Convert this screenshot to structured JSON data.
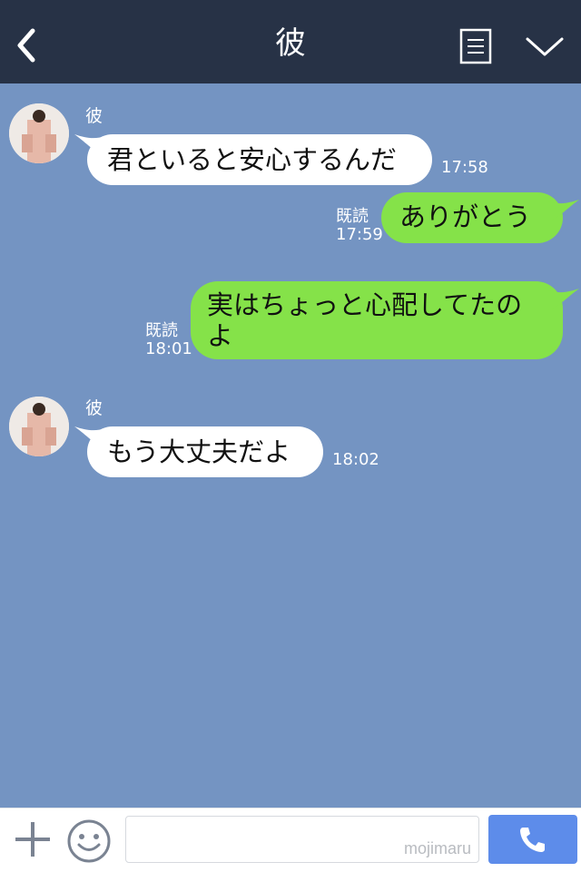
{
  "header": {
    "title": "彼",
    "back_icon": "chevron-left-icon",
    "note_icon": "note-icon",
    "menu_icon": "chevron-down-icon"
  },
  "messages": [
    {
      "sender": "彼",
      "text": "君といると安心するんだ",
      "time": "17:58"
    },
    {
      "text": "ありがとう",
      "read": "既読",
      "time": "17:59"
    },
    {
      "text": "実はちょっと心配してたのよ",
      "read": "既読",
      "time": "18:01"
    },
    {
      "sender": "彼",
      "text": "もう大丈夫だよ",
      "time": "18:02"
    }
  ],
  "input": {
    "placeholder": "",
    "watermark": "mojimaru"
  },
  "colors": {
    "header_bg": "#273246",
    "chat_bg": "#7494c2",
    "incoming_bubble": "#ffffff",
    "outgoing_bubble": "#85e249",
    "call_button": "#5d8cea"
  }
}
